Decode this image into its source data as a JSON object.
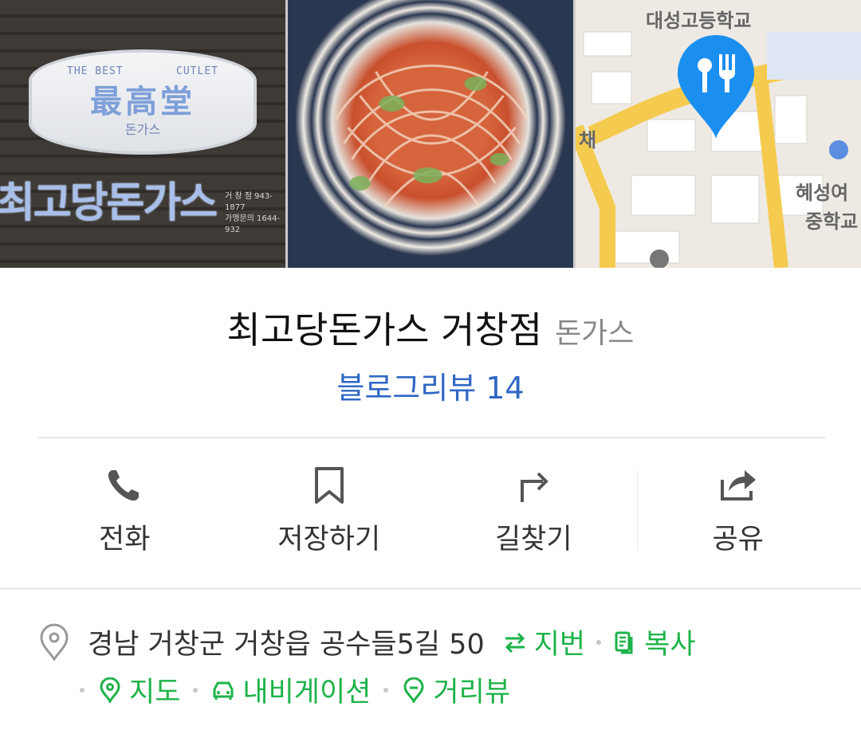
{
  "photos": {
    "store_sign": {
      "best": "THE BEST",
      "cutlet": "CUTLET",
      "main": "最高堂",
      "sub": "돈가스",
      "name": "최고당돈가스",
      "phone1": "거 창 점 943-1877",
      "phone2": "가맹문의 1644-932"
    },
    "map_labels": {
      "school1": "대성고등학교",
      "school2_line1": "혜성여",
      "school2_line2": "중학교",
      "partial": "채"
    }
  },
  "place": {
    "name": "최고당돈가스 거창점",
    "category": "돈가스",
    "review": "블로그리뷰 14"
  },
  "actions": [
    {
      "label": "전화",
      "icon": "phone-icon"
    },
    {
      "label": "저장하기",
      "icon": "bookmark-icon"
    },
    {
      "label": "길찾기",
      "icon": "directions-icon"
    },
    {
      "label": "공유",
      "icon": "share-icon"
    }
  ],
  "address": {
    "text": "경남 거창군 거창읍 공수들5길 50",
    "links": {
      "jibun": "지번",
      "copy": "복사",
      "map": "지도",
      "navigation": "내비게이션",
      "streetview": "거리뷰"
    }
  },
  "colors": {
    "link_green": "#1db34a",
    "review_blue": "#2f67c5",
    "pin_blue": "#1b8ff0"
  }
}
